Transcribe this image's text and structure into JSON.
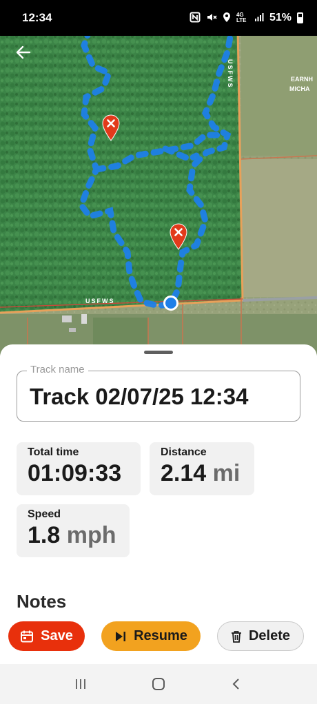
{
  "status_bar": {
    "time": "12:34",
    "battery": "51%",
    "network": "4G LTE",
    "icons": [
      "nfc-icon",
      "mute-icon",
      "location-icon",
      "signal-icon",
      "battery-icon"
    ]
  },
  "map": {
    "labels": {
      "usfws_right": "USFWS",
      "usfws_bottom": "USFWS",
      "place_line1": "EARNH",
      "place_line2": "MICHA"
    },
    "markers": [
      "waypoint-marker",
      "waypoint-marker"
    ],
    "track_color": "#1e7fe8",
    "boundary_color": "#e8a15a"
  },
  "sheet": {
    "track_name_label": "Track name",
    "track_name_value": "Track 02/07/25 12:34",
    "stats": {
      "total_time": {
        "label": "Total time",
        "value": "01:09:33"
      },
      "distance": {
        "label": "Distance",
        "value": "2.14",
        "unit": "mi"
      },
      "speed": {
        "label": "Speed",
        "value": "1.8",
        "unit": "mph"
      }
    },
    "notes_title": "Notes",
    "buttons": {
      "save": "Save",
      "resume": "Resume",
      "delete": "Delete"
    }
  },
  "colors": {
    "save": "#e8300c",
    "resume": "#f2a21f",
    "delete_bg": "#f1f1f1"
  }
}
